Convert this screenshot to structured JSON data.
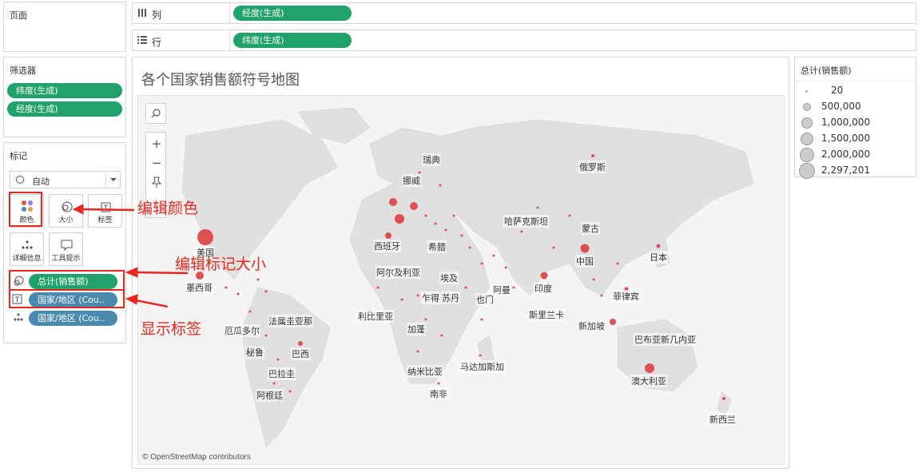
{
  "pages_card": {
    "title": "页面"
  },
  "columns_shelf": {
    "icon": "columns-icon",
    "label": "列",
    "pill": "经度(生成)"
  },
  "rows_shelf": {
    "icon": "rows-icon",
    "label": "行",
    "pill": "纬度(生成)"
  },
  "filters_card": {
    "title": "筛选器",
    "items": [
      "纬度(生成)",
      "经度(生成)"
    ]
  },
  "marks_card": {
    "title": "标记",
    "mark_type": "自动",
    "buttons": {
      "color": "颜色",
      "size": "大小",
      "label": "标签",
      "detail": "详细信息",
      "tooltip": "工具提示"
    },
    "fields": [
      "总计(销售额)",
      "国家/地区 (Cou..",
      "国家/地区 (Cou.."
    ]
  },
  "annotations": {
    "edit_color": "编辑颜色",
    "edit_size": "编辑标记大小",
    "show_label": "显示标签"
  },
  "view": {
    "title": "各个国家销售额符号地图",
    "attribution": "© OpenStreetMap contributors",
    "countries": {
      "sweden": "瑞典",
      "norway": "挪威",
      "russia": "俄罗斯",
      "kazakhstan": "哈萨克斯坦",
      "mongolia": "蒙古",
      "japan": "日本",
      "china": "中国",
      "spain": "西班牙",
      "greece": "希腊",
      "usa": "美国",
      "mexico": "墨西哥",
      "algeria": "阿尔及利亚",
      "egypt": "埃及",
      "oman": "阿曼",
      "chad": "乍得",
      "sudan": "苏丹",
      "yemen": "也门",
      "india": "印度",
      "philippines": "菲律宾",
      "liberia": "利比里亚",
      "gabon": "加蓬",
      "sri_lanka": "斯里兰卡",
      "singapore": "新加坡",
      "ecuador": "厄瓜多尔",
      "french_guiana": "法属圭亚那",
      "papua": "巴布亚新几内亚",
      "peru": "秘鲁",
      "brazil": "巴西",
      "paraguay": "巴拉圭",
      "namibia": "纳米比亚",
      "madagascar": "马达加斯加",
      "south_africa": "南非",
      "argentina": "阿根廷",
      "australia": "澳大利亚",
      "new_zealand": "新西兰"
    }
  },
  "legend": {
    "title": "总计(销售额)",
    "items": [
      "20",
      "500,000",
      "1,000,000",
      "1,500,000",
      "2,000,000",
      "2,297,201"
    ]
  },
  "colors": {
    "pill_green": "#1fa36a",
    "pill_blue": "#4a8ab0",
    "mark_red": "#e05050",
    "annotation_red": "#e8281f"
  }
}
